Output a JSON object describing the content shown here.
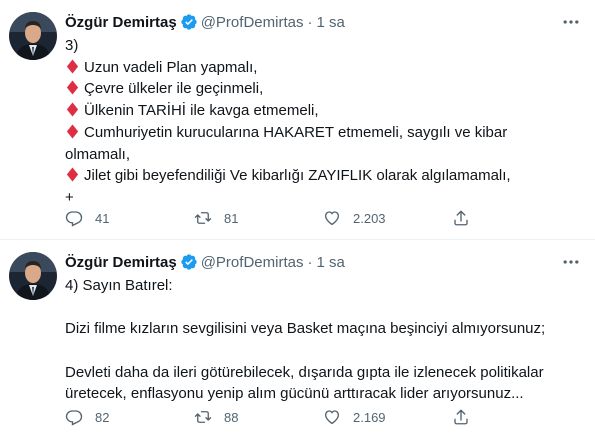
{
  "tweets": [
    {
      "author_name": "Özgür Demirtaş",
      "handle": "@ProfDemirtas",
      "separator": "·",
      "time": "1 sa",
      "lines": [
        {
          "text": "3)",
          "bullet": false
        },
        {
          "text": "Uzun vadeli Plan yapmalı,",
          "bullet": true
        },
        {
          "text": "Çevre ülkeler ile geçinmeli,",
          "bullet": true
        },
        {
          "text": "Ülkenin TARİHİ ile kavga etmemeli,",
          "bullet": true
        },
        {
          "text": "Cumhuriyetin kurucularına HAKARET etmemeli, saygılı ve kibar",
          "bullet": true
        },
        {
          "text": "olmamalı,",
          "bullet": false
        },
        {
          "text": "Jilet gibi beyefendiliği Ve kibarlığı ZAYIFLIK olarak algılamamalı,",
          "bullet": true
        },
        {
          "text": "+",
          "bullet": false
        }
      ],
      "replies": "41",
      "retweets": "81",
      "likes": "2.203"
    },
    {
      "author_name": "Özgür Demirtaş",
      "handle": "@ProfDemirtas",
      "separator": "·",
      "time": "1 sa",
      "lines": [
        {
          "text": "4) Sayın Batırel:"
        },
        {
          "text": ""
        },
        {
          "text": "Dizi filme kızların sevgilisini veya Basket maçına beşinciyi almıyorsunuz;"
        },
        {
          "text": ""
        },
        {
          "text": "Devleti daha da ileri götürebilecek, dışarıda gıpta ile izlenecek politikalar"
        },
        {
          "text": "üretecek, enflasyonu yenip alım gücünü arttıracak lider arıyorsunuz..."
        }
      ],
      "replies": "82",
      "retweets": "88",
      "likes": "2.169"
    }
  ],
  "colors": {
    "text": "#0f1419",
    "secondary": "#536471",
    "verified": "#1d9bf0",
    "bullet": "#dd2e44",
    "divider": "#eff3f4"
  },
  "icons": {
    "reply": "reply-icon",
    "retweet": "retweet-icon",
    "like": "heart-icon",
    "share": "share-icon",
    "more": "more-icon",
    "verified": "verified-badge-icon",
    "bullet": "red-diamond-icon"
  }
}
